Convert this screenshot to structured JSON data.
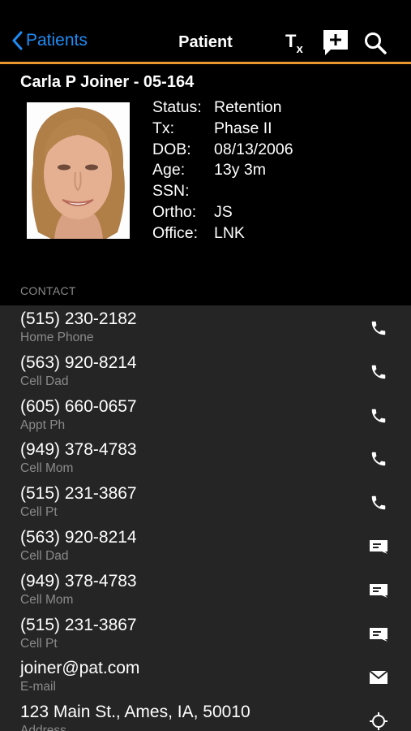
{
  "nav": {
    "back_label": "Patients",
    "title": "Patient",
    "tx_label": "T",
    "tx_sub": "x",
    "icons": [
      "back-chevron-icon",
      "tx-icon",
      "add-note-icon",
      "search-icon"
    ]
  },
  "accent_color": "#e8962e",
  "link_color": "#1e8cf5",
  "patient": {
    "name": "Carla P Joiner - 05-164",
    "info": [
      {
        "label": "Status:",
        "value": "Retention"
      },
      {
        "label": "Tx:",
        "value": "Phase II"
      },
      {
        "label": "DOB:",
        "value": "08/13/2006"
      },
      {
        "label": "Age:",
        "value": "13y 3m"
      },
      {
        "label": "SSN:",
        "value": ""
      },
      {
        "label": "Ortho:",
        "value": "JS"
      },
      {
        "label": "Office:",
        "value": "LNK"
      }
    ]
  },
  "contact": {
    "header": "CONTACT",
    "items": [
      {
        "value": "(515) 230-2182",
        "type": "Home Phone",
        "icon": "phone-icon"
      },
      {
        "value": "(563) 920-8214",
        "type": "Cell Dad",
        "icon": "phone-icon"
      },
      {
        "value": "(605) 660-0657",
        "type": "Appt Ph",
        "icon": "phone-icon"
      },
      {
        "value": "(949) 378-4783",
        "type": "Cell Mom",
        "icon": "phone-icon"
      },
      {
        "value": "(515) 231-3867",
        "type": "Cell Pt",
        "icon": "phone-icon"
      },
      {
        "value": "(563) 920-8214",
        "type": "Cell Dad",
        "icon": "message-icon"
      },
      {
        "value": "(949) 378-4783",
        "type": "Cell Mom",
        "icon": "message-icon"
      },
      {
        "value": "(515) 231-3867",
        "type": "Cell Pt",
        "icon": "message-icon"
      },
      {
        "value": "joiner@pat.com",
        "type": "E-mail",
        "icon": "mail-icon"
      },
      {
        "value": "123 Main St., Ames, IA, 50010",
        "type": "Address",
        "icon": "location-icon"
      }
    ]
  }
}
